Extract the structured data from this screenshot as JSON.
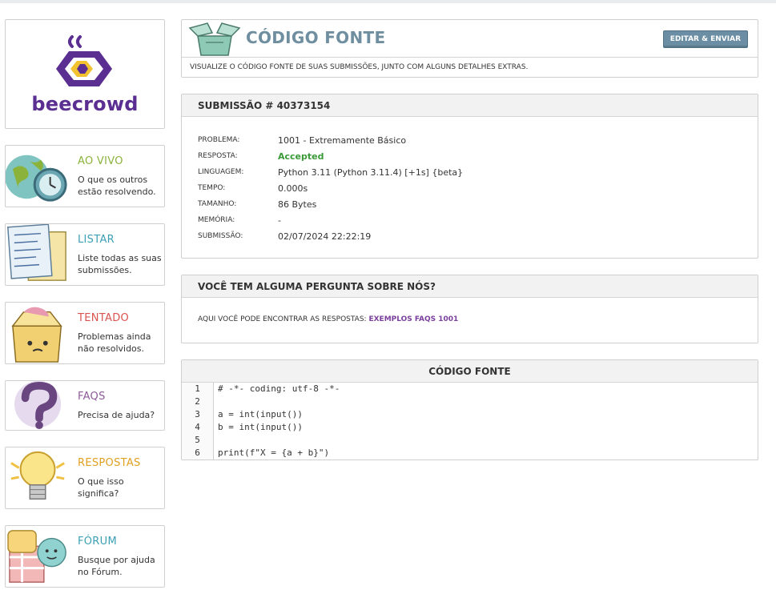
{
  "sidebar": {
    "logo_text": "beecrowd",
    "cards": [
      {
        "title": "AO VIVO",
        "desc": "O que os outros estão resolvendo.",
        "color": "#8bb33c"
      },
      {
        "title": "LISTAR",
        "desc": "Liste todas as suas submissões.",
        "color": "#3c9fb4"
      },
      {
        "title": "TENTADO",
        "desc": "Problemas ainda não resolvidos.",
        "color": "#d9534f"
      },
      {
        "title": "FAQS",
        "desc": "Precisa de ajuda?",
        "color": "#8e5a9a"
      },
      {
        "title": "RESPOSTAS",
        "desc": "O que isso significa?",
        "color": "#e0a020"
      },
      {
        "title": "FÓRUM",
        "desc": "Busque por ajuda no Fórum.",
        "color": "#3c9fb4"
      }
    ]
  },
  "codigo": {
    "title": "CÓDIGO FONTE",
    "button": "EDITAR & ENVIAR",
    "subtitle": "VISUALIZE O CÓDIGO FONTE DE SUAS SUBMISSÕES, JUNTO COM ALGUNS DETALHES EXTRAS."
  },
  "submission": {
    "header": "SUBMISSÃO # 40373154",
    "rows": [
      {
        "label": "PROBLEMA:",
        "value": "1001 - Extremamente Básico"
      },
      {
        "label": "RESPOSTA:",
        "value": "Accepted"
      },
      {
        "label": "LINGUAGEM:",
        "value": "Python 3.11 (Python 3.11.4) [+1s] {beta}"
      },
      {
        "label": "TEMPO:",
        "value": "0.000s"
      },
      {
        "label": "TAMANHO:",
        "value": "86 Bytes"
      },
      {
        "label": "MEMÓRIA:",
        "value": "-"
      },
      {
        "label": "SUBMISSÃO:",
        "value": "02/07/2024 22:22:19"
      }
    ]
  },
  "question": {
    "header": "VOCÊ TEM ALGUMA PERGUNTA SOBRE NÓS?",
    "text": "AQUI VOCÊ PODE ENCONTRAR AS RESPOSTAS:",
    "link": "EXEMPLOS FAQS 1001"
  },
  "source": {
    "header": "CÓDIGO FONTE",
    "line_numbers": [
      "1",
      "2",
      "3",
      "4",
      "5",
      "6"
    ],
    "lines": [
      "# -*- coding: utf-8 -*-",
      "",
      "a = int(input())",
      "b = int(input())",
      "",
      "print(f\"X = {a + b}\")"
    ]
  }
}
